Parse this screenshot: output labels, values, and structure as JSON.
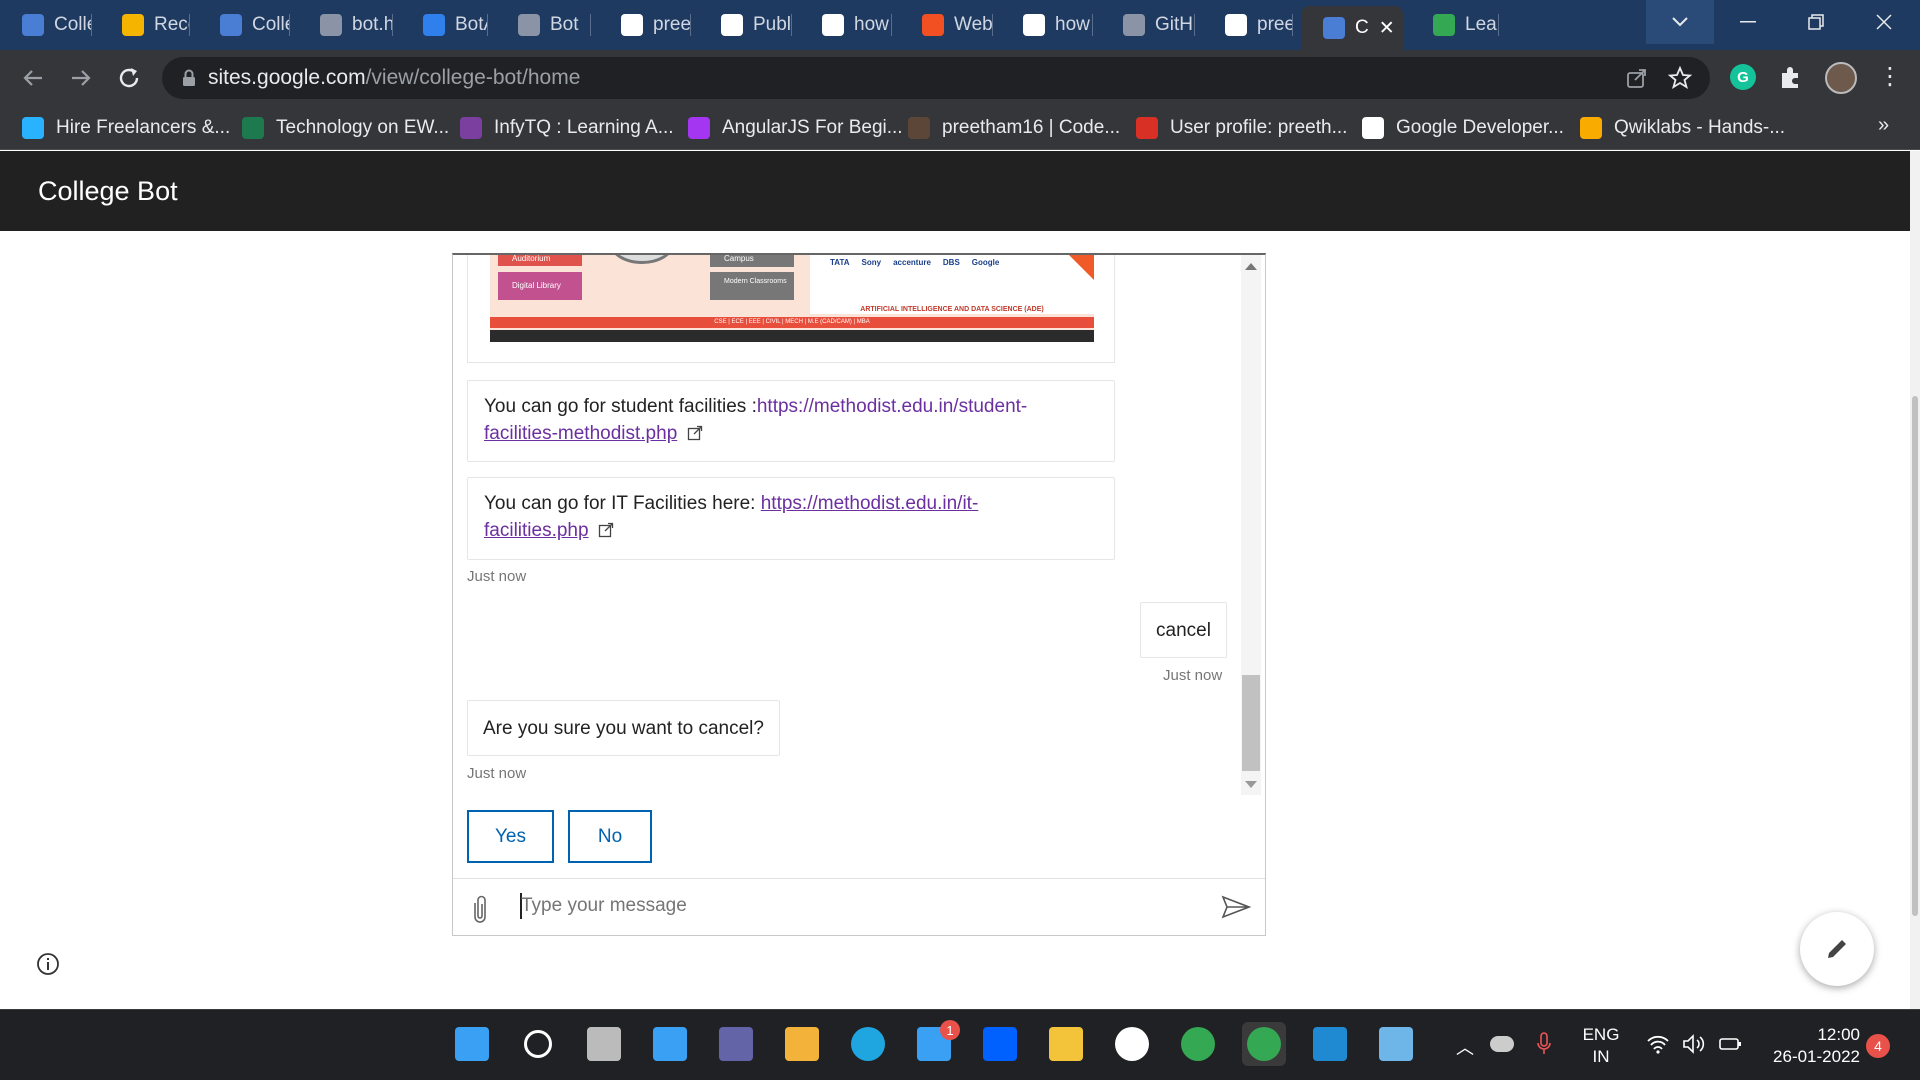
{
  "browser": {
    "tabs": [
      {
        "label": "Colle",
        "icon": "sites-icon",
        "color": "#4a7dd4"
      },
      {
        "label": "Rece",
        "icon": "drive-icon",
        "color": "#f4b400"
      },
      {
        "label": "Colle",
        "icon": "sites-icon",
        "color": "#4a7dd4"
      },
      {
        "label": "bot.h",
        "icon": "globe-icon",
        "color": "#8a94a6"
      },
      {
        "label": "BotA",
        "icon": "botanalytics-icon",
        "color": "#2f80ed"
      },
      {
        "label": "Bot",
        "icon": "globe-icon",
        "color": "#8a94a6"
      },
      {
        "label": "preet",
        "icon": "github-icon",
        "color": "#ffffff"
      },
      {
        "label": "Publi",
        "icon": "at-icon",
        "color": "#ffffff"
      },
      {
        "label": "how",
        "icon": "google-icon",
        "color": "#ffffff"
      },
      {
        "label": "Web",
        "icon": "microsoft-icon",
        "color": "#f25022"
      },
      {
        "label": "how",
        "icon": "google-icon",
        "color": "#ffffff"
      },
      {
        "label": "GitH",
        "icon": "globe-icon",
        "color": "#8a94a6"
      },
      {
        "label": "pree",
        "icon": "github-icon",
        "color": "#ffffff"
      },
      {
        "label": "C",
        "icon": "sites-icon",
        "color": "#4a7dd4",
        "active": true
      },
      {
        "label": "Learr",
        "icon": "qwiklabs-icon",
        "color": "#34a853"
      }
    ],
    "close_tab_glyph": "✕",
    "new_tab_glyph": "+",
    "url_domain": "sites.google.com",
    "url_path": "/view/college-bot/home",
    "bookmarks": [
      {
        "label": "Hire Freelancers &...",
        "icon": "freelancer-icon",
        "color": "#29b2fe"
      },
      {
        "label": "Technology on EW...",
        "icon": "ew-icon",
        "color": "#1d7a4f"
      },
      {
        "label": "InfyTQ : Learning A...",
        "icon": "infytq-icon",
        "color": "#7b3fa0"
      },
      {
        "label": "AngularJS For Begi...",
        "icon": "udemy-icon",
        "color": "#a435f0"
      },
      {
        "label": "preetham16 | Code...",
        "icon": "codechef-icon",
        "color": "#5b4638"
      },
      {
        "label": "User profile: preeth...",
        "icon": "spoj-icon",
        "color": "#d93025"
      },
      {
        "label": "Google Developer...",
        "icon": "gdev-icon",
        "color": "#ffffff"
      },
      {
        "label": "Qwiklabs - Hands-...",
        "icon": "qwiklabs-icon",
        "color": "#f9ab00"
      }
    ],
    "more_bookmarks": "»"
  },
  "site": {
    "title": "College Bot"
  },
  "chat": {
    "msg1_text": "You can go for student facilities :",
    "msg1_link": "https://methodist.edu.in/student-facilities-methodist.php",
    "msg2_text": "You can go for IT Facilities here: ",
    "msg2_link": "https://methodist.edu.in/it-facilities.php",
    "ts1": "Just now",
    "user_msg": "cancel",
    "ts2": "Just now",
    "bot_msg": "Are you sure you want to cancel?",
    "ts3": "Just now",
    "yes_label": "Yes",
    "no_label": "No",
    "input_placeholder": "Type your message",
    "banner_labels": [
      "Auditorium",
      "Campus",
      "Digital Library",
      "Modern Classrooms"
    ],
    "banner_text": "ARTIFICIAL INTELLIGENCE AND DATA SCIENCE (ADE)",
    "banner_sub": "CSE | ECE | EEE | CIVIL | MECH | M.E (CAD/CAM) | MBA",
    "banner_logos": [
      "TATA",
      "Sony",
      "accenture",
      "DBS",
      "Google"
    ]
  },
  "taskbar": {
    "lang_top": "ENG",
    "lang_bottom": "IN",
    "time": "12:00",
    "date": "26-01-2022",
    "notification_count": "4",
    "mail_badge": "1",
    "icons": [
      "windows-start-icon",
      "search-icon",
      "task-view-icon",
      "widgets-icon",
      "teams-chat-icon",
      "store-icon",
      "edge-icon",
      "mail-icon",
      "dropbox-icon",
      "file-explorer-icon",
      "github-desktop-icon",
      "chrome-icon",
      "chrome-profile-icon",
      "vscode-icon",
      "virtualbox-icon"
    ]
  },
  "colors": {
    "tabstrip": "#1f3a60",
    "toolbar": "#35363a",
    "site_header": "#212121",
    "accent_button": "#0063b1",
    "link": "#6b2fa0"
  }
}
